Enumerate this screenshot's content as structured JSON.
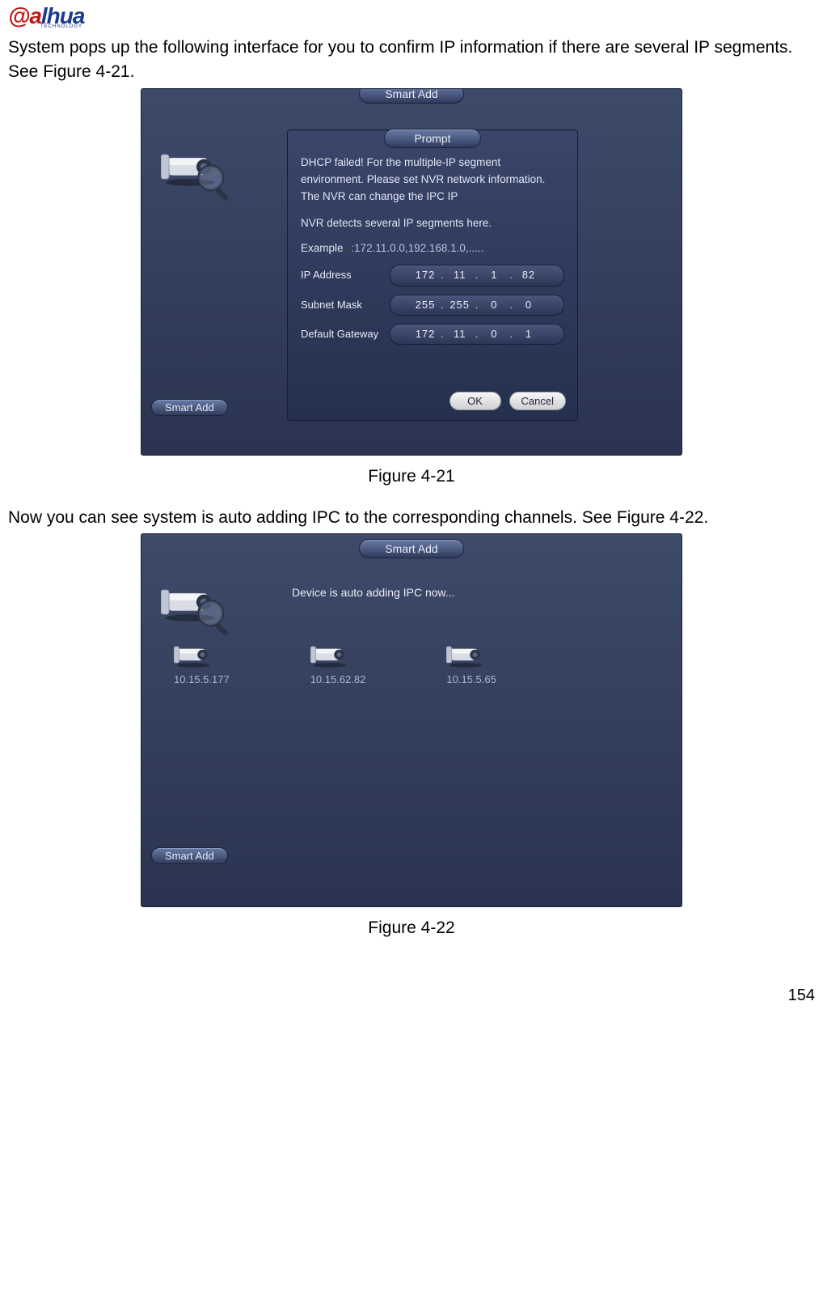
{
  "brand": {
    "name_a": "a",
    "name_rest": "lhua",
    "sub": "TECHNOLOGY"
  },
  "intro1": "System pops up the following interface for you to confirm IP information if there are several IP segments. See Figure 4-21.",
  "intro2": "Now you can see system is auto adding IPC to the corresponding channels. See Figure 4-22.",
  "fig421": "Figure 4-21",
  "fig422": "Figure 4-22",
  "page_number": "154",
  "shot1": {
    "title": "Smart Add",
    "prompt_title": "Prompt",
    "msg": "DHCP failed! For the multiple-IP segment environment. Please set NVR network information. The NVR can change the IPC IP",
    "detect": "NVR detects several IP segments here.",
    "example_label": "Example",
    "example_value": ":172.11.0.0,192.168.1.0,.....",
    "rows": [
      {
        "label": "IP Address",
        "oct": [
          "172",
          "11",
          "1",
          "82"
        ]
      },
      {
        "label": "Subnet Mask",
        "oct": [
          "255",
          "255",
          "0",
          "0"
        ]
      },
      {
        "label": "Default Gateway",
        "oct": [
          "172",
          "11",
          "0",
          "1"
        ]
      }
    ],
    "ok": "OK",
    "cancel": "Cancel",
    "smart_add_btn": "Smart Add"
  },
  "shot2": {
    "title": "Smart Add",
    "auto_adding": "Device is auto adding IPC now...",
    "cams": [
      {
        "ip": "10.15.5.177"
      },
      {
        "ip": "10.15.62.82"
      },
      {
        "ip": "10.15.5.65"
      }
    ],
    "smart_add_btn": "Smart Add"
  }
}
